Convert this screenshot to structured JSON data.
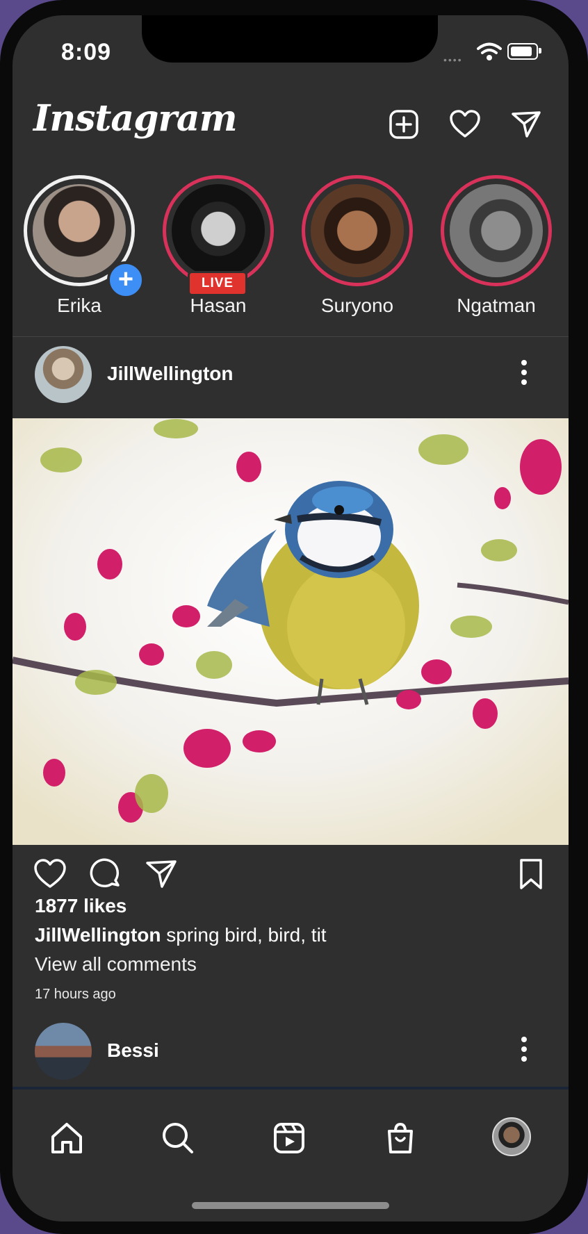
{
  "status": {
    "time": "8:09"
  },
  "header": {
    "logo": "Instagram"
  },
  "stories": [
    {
      "name": "Erika",
      "badge": "+",
      "ring": "seen"
    },
    {
      "name": "Hasan",
      "badge": "LIVE",
      "ring": "new"
    },
    {
      "name": "Suryono",
      "badge": "",
      "ring": "new"
    },
    {
      "name": "Ngatman",
      "badge": "",
      "ring": "new"
    }
  ],
  "post": {
    "username": "JillWellington",
    "likes": "1877 likes",
    "caption_user": "JillWellington",
    "caption_text": "spring bird, bird, tit",
    "view_comments": "View all comments",
    "time_ago": "17 hours ago"
  },
  "next_post": {
    "username": "Bessi"
  },
  "colors": {
    "background": "#2f2f2f",
    "story_ring": "#d8325b",
    "add_badge": "#3d8ef5",
    "live_badge": "#e0332e"
  },
  "icons": [
    "add-post-icon",
    "heart-icon",
    "send-icon",
    "comment-icon",
    "bookmark-icon",
    "more-icon",
    "home-icon",
    "search-icon",
    "reels-icon",
    "shop-icon",
    "profile-avatar"
  ]
}
